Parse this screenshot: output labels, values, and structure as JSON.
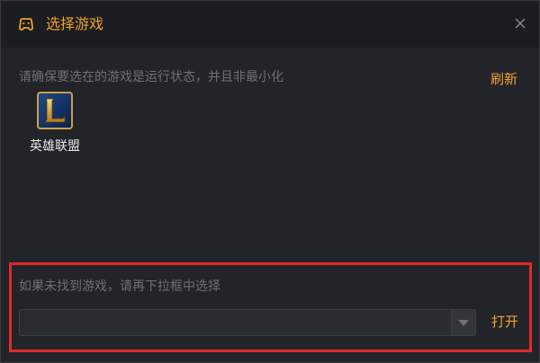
{
  "window": {
    "title": "选择游戏",
    "title_icon": "gamepad-icon",
    "close_icon": "close-icon"
  },
  "main": {
    "hint": "请确保要选在的游戏是运行状态，并且非最小化",
    "refresh_label": "刷新",
    "games": [
      {
        "name": "英雄联盟",
        "icon": "league-of-legends-icon"
      }
    ]
  },
  "select_panel": {
    "hint": "如果未找到游戏，请再下拉框中选择",
    "dropdown": {
      "selected": ""
    },
    "open_label": "打开"
  },
  "colors": {
    "accent": "#f0a030",
    "highlight_border": "#e02a2a",
    "background": "#232429",
    "titlebar": "#1c1d21",
    "muted_text": "#6e7078"
  }
}
